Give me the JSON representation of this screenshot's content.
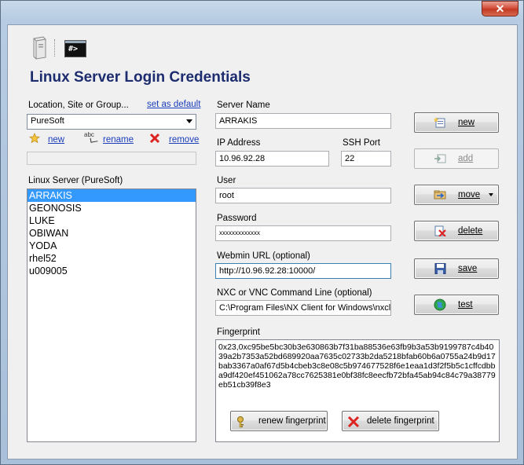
{
  "window": {
    "close_glyph": "✕"
  },
  "header": {
    "title": "Linux Server Login Credentials",
    "terminal_text": "#>"
  },
  "location": {
    "label": "Location, Site or Group...",
    "set_default": "set as default",
    "selected": "PureSoft",
    "actions": {
      "new": "new",
      "rename": "rename",
      "remove": "remove"
    },
    "rename_icon_text": "abc"
  },
  "servers": {
    "label": "Linux Server (PureSoft)",
    "items": [
      "ARRAKIS",
      "GEONOSIS",
      "LUKE",
      "OBIWAN",
      "YODA",
      "rhel52",
      "u009005"
    ]
  },
  "form": {
    "server_name_label": "Server Name",
    "server_name": "ARRAKIS",
    "ip_label": "IP Address",
    "ip": "10.96.92.28",
    "ssh_port_label": "SSH Port",
    "ssh_port": "22",
    "user_label": "User",
    "user": "root",
    "password_label": "Password",
    "password": "xxxxxxxxxxxxx",
    "webmin_label": "Webmin URL (optional)",
    "webmin": "http://10.96.92.28:10000/",
    "nxc_label": "NXC or VNC Command Line (optional)",
    "nxc": "C:\\Program Files\\NX Client for Windows\\nxclie",
    "fingerprint_label": "Fingerprint",
    "fingerprint": "0x23,0xc95be5bc30b3e630863b7f31ba88536e63fb9b3a53b9199787c4b4039a2b7353a52bd689920aa7635c02733b2da5218bfab60b6a0755a24b9d17bab3367a0af67d5b4cbeb3c8e08c5b974677528f6e1eaa1d3f2f5b5c1cffcdbba9df420ef451062a78cc7625381e0bf38fc8eecfb72bfa45ab94c84c79a38779eb51cb39f8e3"
  },
  "buttons": {
    "new": "new",
    "add": "add",
    "move": "move",
    "delete": "delete",
    "save": "save",
    "test": "test",
    "renew_fingerprint": "renew fingerprint",
    "delete_fingerprint": "delete fingerprint"
  }
}
